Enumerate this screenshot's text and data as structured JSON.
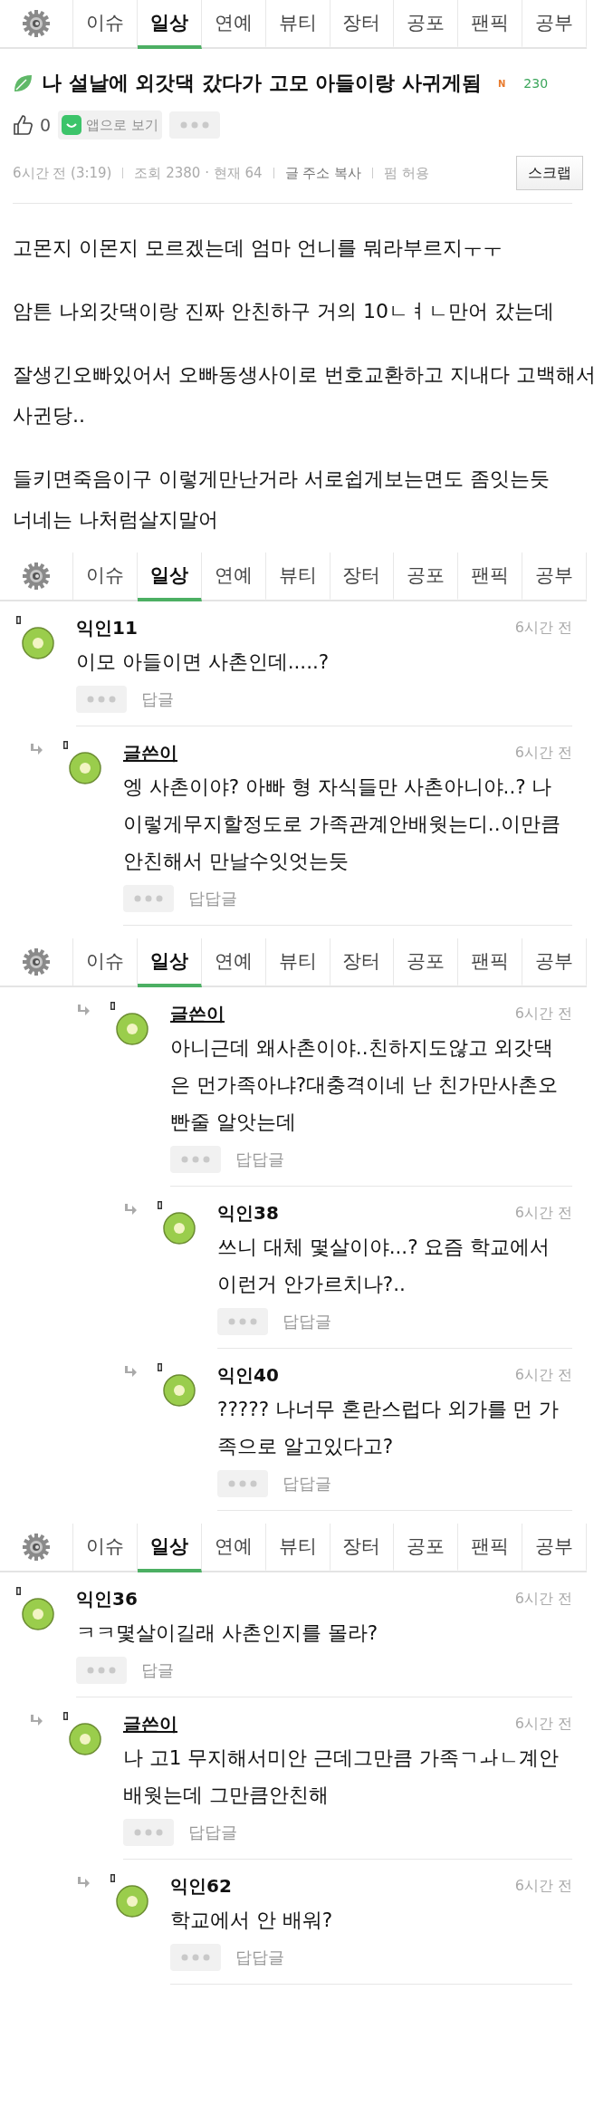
{
  "segments": [
    {
      "tabs": [
        {
          "label": "이슈",
          "selected": false
        },
        {
          "label": "일상",
          "selected": true
        },
        {
          "label": "연예",
          "selected": false
        },
        {
          "label": "뷰티",
          "selected": false
        },
        {
          "label": "장터",
          "selected": false
        },
        {
          "label": "공포",
          "selected": false
        },
        {
          "label": "팬픽",
          "selected": false
        },
        {
          "label": "공부",
          "selected": false
        }
      ],
      "post": {
        "title": "나 설날에 외갓댁 갔다가 고모 아들이랑 사귀게됨",
        "badge": "N",
        "comment_count": "230",
        "likes": "0",
        "app_button": "앱으로 보기",
        "time": "6시간 전 (3:19)",
        "views": "조회 2380 · 현재 64",
        "copy_link": "글 주소 복사",
        "repost": "펌 허용",
        "scrap_button": "스크랩",
        "paragraphs": [
          [
            "고몬지 이몬지 모르겠는데 엄마 언니를 뭐라부르지ㅜㅜ"
          ],
          [
            "암튼 나외갓댁이랑 진짜 안친하구 거의 10ㄴㅕㄴ만어 갔는데"
          ],
          [
            "잘생긴오빠있어서 오빠동생사이로 번호교환하고 지내다 고백해서 사귄당.."
          ],
          [
            "들키면죽음이구 이렇게만난거라 서로쉽게보는면도 좀잇는듯",
            "너네는 나처럼살지말어"
          ]
        ]
      }
    },
    {
      "tabs": [
        {
          "label": "이슈",
          "selected": false
        },
        {
          "label": "일상",
          "selected": true
        },
        {
          "label": "연예",
          "selected": false
        },
        {
          "label": "뷰티",
          "selected": false
        },
        {
          "label": "장터",
          "selected": false
        },
        {
          "label": "공포",
          "selected": false
        },
        {
          "label": "팬픽",
          "selected": false
        },
        {
          "label": "공부",
          "selected": false
        }
      ],
      "comments": [
        {
          "kind": "comment",
          "author": "익인11",
          "writer": false,
          "time": "6시간 전",
          "text": "이모 아들이면 사촌인데.....?",
          "reply": "답글",
          "children": [
            {
              "kind": "comment",
              "author": "글쓴이",
              "writer": true,
              "time": "6시간 전",
              "text": "엥 사촌이야? 아빠 형 자식들만 사촌아니야..? 나 이렇게무지할정도로 가족관계안배웟는디..이만큼 안친해서 만날수잇엇는듯",
              "reply": "답답글"
            }
          ]
        }
      ]
    },
    {
      "tabs": [
        {
          "label": "이슈",
          "selected": false
        },
        {
          "label": "일상",
          "selected": true
        },
        {
          "label": "연예",
          "selected": false
        },
        {
          "label": "뷰티",
          "selected": false
        },
        {
          "label": "장터",
          "selected": false
        },
        {
          "label": "공포",
          "selected": false
        },
        {
          "label": "팬픽",
          "selected": false
        },
        {
          "label": "공부",
          "selected": false
        }
      ],
      "comments": [
        {
          "kind": "hidden-parent",
          "children": [
            {
              "kind": "hidden-parent",
              "children": [
                {
                  "kind": "comment",
                  "author": "글쓴이",
                  "writer": true,
                  "time": "6시간 전",
                  "text": "아니근데 왜사촌이야..친하지도않고 외갓댁은 먼가족아냐?대충격이네 난 친가만사촌오빤줄 알앗는데",
                  "reply": "답답글",
                  "children": [
                    {
                      "kind": "comment",
                      "author": "익인38",
                      "writer": false,
                      "time": "6시간 전",
                      "text": "쓰니 대체 몇살이야...? 요즘 학교에서 이런거 안가르치나?..",
                      "reply": "답답글"
                    },
                    {
                      "kind": "comment",
                      "author": "익인40",
                      "writer": false,
                      "time": "6시간 전",
                      "text": "????? 나너무 혼란스럽다 외가를 먼 가족으로 알고있다고?",
                      "reply": "답답글"
                    }
                  ]
                }
              ]
            }
          ]
        }
      ]
    },
    {
      "tabs": [
        {
          "label": "이슈",
          "selected": false
        },
        {
          "label": "일상",
          "selected": true
        },
        {
          "label": "연예",
          "selected": false
        },
        {
          "label": "뷰티",
          "selected": false
        },
        {
          "label": "장터",
          "selected": false
        },
        {
          "label": "공포",
          "selected": false
        },
        {
          "label": "팬픽",
          "selected": false
        },
        {
          "label": "공부",
          "selected": false
        }
      ],
      "comments": [
        {
          "kind": "comment",
          "author": "익인36",
          "writer": false,
          "time": "6시간 전",
          "text": "ㅋㅋ몇살이길래 사촌인지를 몰라?",
          "reply": "답글",
          "children": [
            {
              "kind": "comment",
              "author": "글쓴이",
              "writer": true,
              "time": "6시간 전",
              "text": "나 고1 무지해서미안 근데그만큼 가족ㄱㅘㄴ계안배웟는데 그만큼안친해",
              "reply": "답답글",
              "children": [
                {
                  "kind": "comment",
                  "author": "익인62",
                  "writer": false,
                  "time": "6시간 전",
                  "text": "학교에서 안 배워?",
                  "reply": "답답글"
                }
              ]
            }
          ]
        }
      ]
    }
  ]
}
